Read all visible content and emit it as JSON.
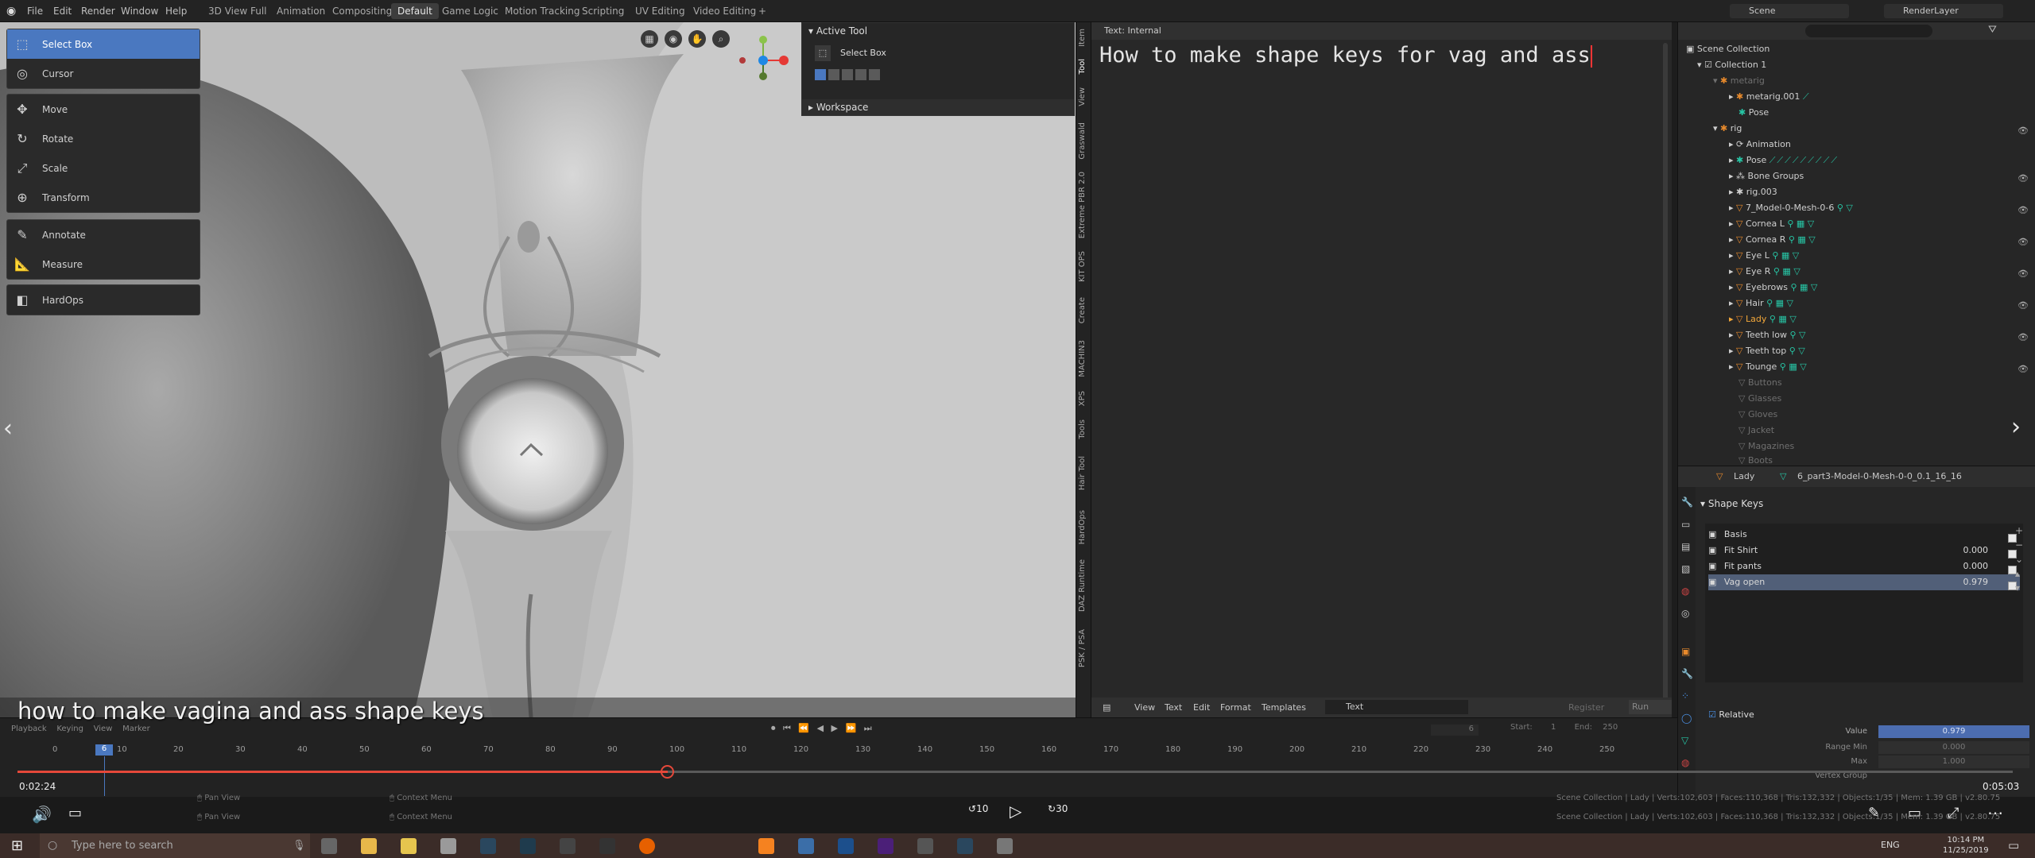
{
  "topbar": {
    "menus": [
      "File",
      "Edit",
      "Render",
      "Window",
      "Help"
    ],
    "workspaces": [
      "3D View Full",
      "Animation",
      "Compositing",
      "Default",
      "Game Logic",
      "Motion Tracking",
      "Scripting",
      "UV Editing",
      "Video Editing",
      "+"
    ],
    "scene_label": "Scene",
    "renderlayer_label": "RenderLayer"
  },
  "toolbar": {
    "items": [
      "Select Box",
      "Cursor",
      "Move",
      "Rotate",
      "Scale",
      "Transform",
      "Annotate",
      "Measure",
      "HardOps"
    ]
  },
  "active_tool": {
    "header": "Active Tool",
    "tool": "Select Box",
    "workspace": "Workspace"
  },
  "side_tabs": [
    "Item",
    "Tool",
    "View",
    "Graswald",
    "Extreme PBR 2.0",
    "KIT OPS",
    "Create",
    "MACHIN3",
    "XPS",
    "Tools",
    "Hair Tool",
    "HardOps",
    "DAZ Runtime",
    "PSK / PSA"
  ],
  "text_editor": {
    "header": "Text: Internal",
    "content": "How to make shape keys for vag and ass",
    "menu": [
      "View",
      "Text",
      "Edit",
      "Format",
      "Templates"
    ],
    "file": "Text",
    "register": "Register",
    "run_script": "Run Script"
  },
  "outliner": {
    "rows": [
      "Scene Collection",
      "Collection 1",
      "metarig",
      "metarig.001",
      "Pose",
      "rig",
      "Animation",
      "Pose",
      "Bone Groups",
      "rig.003",
      "7_Model-0-Mesh-0-6",
      "Cornea L",
      "Cornea R",
      "Eye L",
      "Eye R",
      "Eyebrows",
      "Hair",
      "Lady",
      "Teeth low",
      "Teeth top",
      "Tounge",
      "Buttons",
      "Glasses",
      "Gloves",
      "Jacket",
      "Magazines",
      "Boots"
    ]
  },
  "properties": {
    "object": "Lady",
    "mesh": "6_part3-Model-0-Mesh-0-0_0.1_16_16",
    "section": "Shape Keys",
    "keys": [
      {
        "name": "Basis",
        "value": ""
      },
      {
        "name": "Fit Shirt",
        "value": "0.000"
      },
      {
        "name": "Fit pants",
        "value": "0.000"
      },
      {
        "name": "Vag open",
        "value": "0.979"
      }
    ],
    "relative": "Relative",
    "value_label": "Value",
    "value": "0.979",
    "range_min_label": "Range Min",
    "range_min": "0.000",
    "max_label": "Max",
    "max": "1.000",
    "vertex_group": "Vertex Group"
  },
  "timeline": {
    "menus": [
      "Playback",
      "Keying",
      "View",
      "Marker"
    ],
    "ticks": [
      "0",
      "10",
      "20",
      "30",
      "40",
      "50",
      "60",
      "70",
      "80",
      "90",
      "100",
      "110",
      "120",
      "130",
      "140",
      "150",
      "160",
      "170",
      "180",
      "190",
      "200",
      "210",
      "220",
      "230",
      "240",
      "250"
    ],
    "current_frame": "6",
    "start_label": "Start:",
    "start": "1",
    "end_label": "End:",
    "end": "250"
  },
  "status": {
    "line1": "Pan View",
    "line2": "Context Menu",
    "stats": "Scene Collection | Lady | Verts:102,603 | Faces:110,368 | Tris:132,332 | Objects:1/35 | Mem: 1.39 GB | v2.80.75"
  },
  "video": {
    "caption": "how to make vagina and ass shape keys",
    "elapsed": "0:02:24",
    "duration": "0:05:03",
    "progress": 0.326,
    "rewind": "10",
    "forward": "30"
  },
  "taskbar": {
    "search_placeholder": "Type here to search",
    "time": "10:14 PM",
    "date": "11/25/2019",
    "lang": "ENG"
  }
}
